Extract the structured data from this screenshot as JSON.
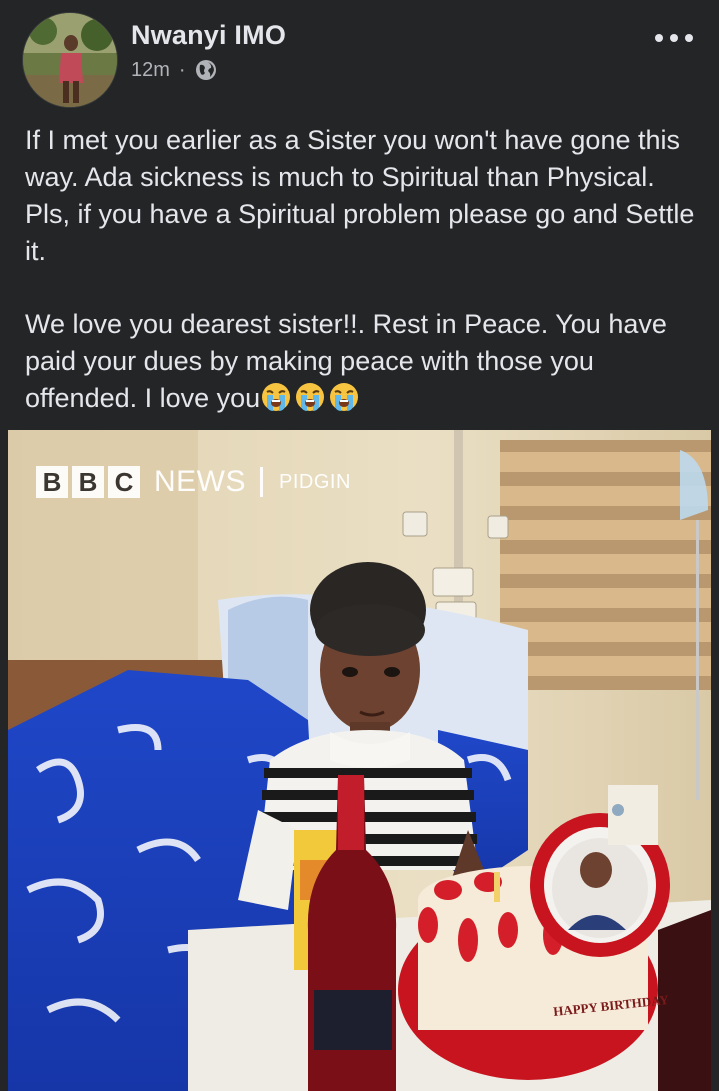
{
  "post": {
    "author": "Nwanyi IMO",
    "timestamp": "12m",
    "separator": "·",
    "privacy_icon": "globe-icon",
    "more_icon": "more-options-icon",
    "paragraphs": [
      "If I met you earlier as a Sister you won't have gone this way.  Ada sickness is much to Spiritual than Physical.  Pls, if you have a Spiritual problem please go and Settle it.",
      "We love you dearest sister!!. Rest in Peace. You have paid your dues by making peace with those you offended.  I love you"
    ],
    "trailing_emojis": [
      "😭",
      "😭",
      "😭"
    ]
  },
  "photo": {
    "watermark": {
      "blocks": [
        "B",
        "B",
        "C"
      ],
      "news": "NEWS",
      "separator": "|",
      "section": "PIDGIN"
    },
    "cake_text": "HAPPY BIRTHDAY"
  },
  "colors": {
    "background": "#242526",
    "text_primary": "#e4e6eb",
    "text_secondary": "#b0b3b8"
  }
}
